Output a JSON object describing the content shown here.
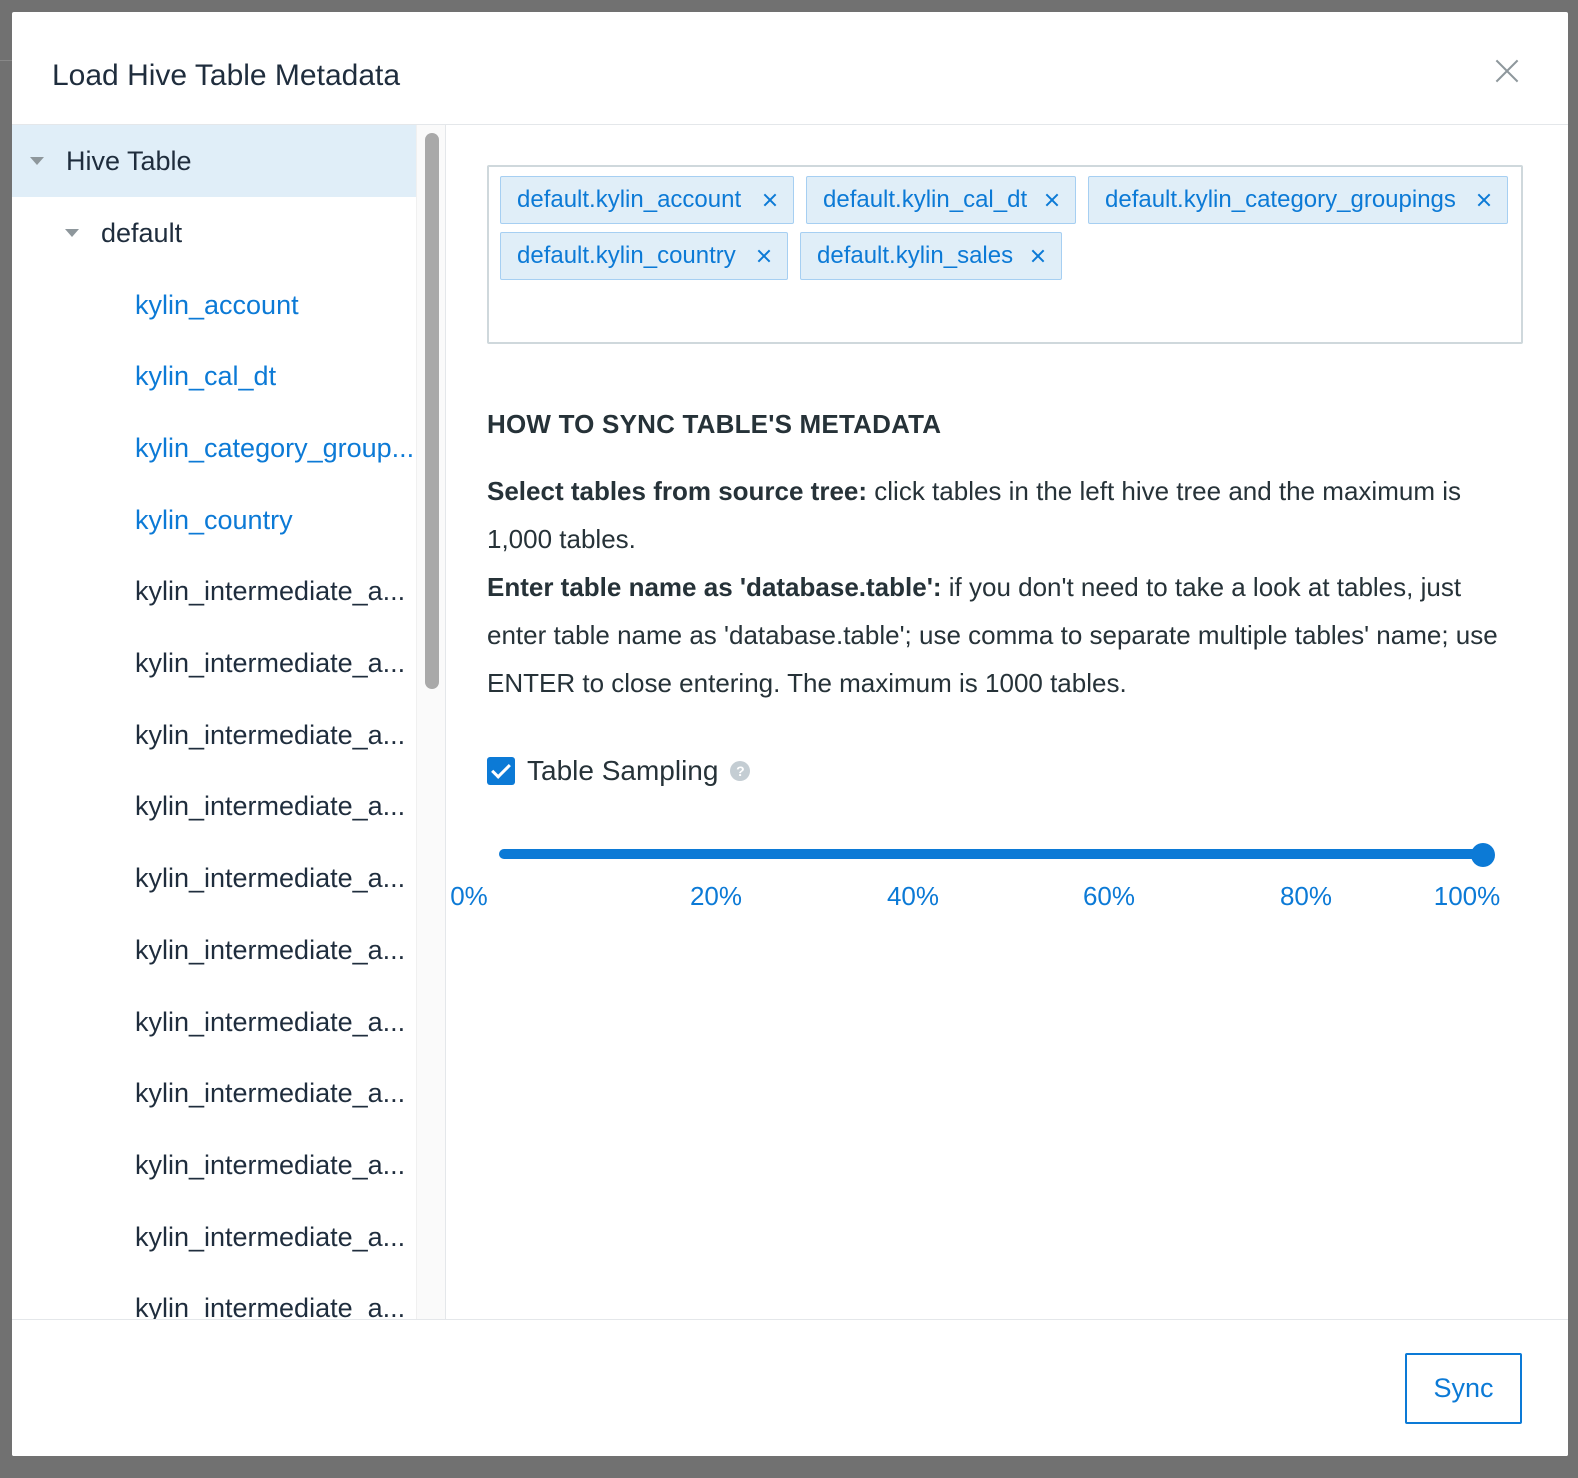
{
  "dialog": {
    "title": "Load Hive Table Metadata"
  },
  "tree": {
    "root_label": "Hive Table",
    "database_label": "default",
    "items": [
      {
        "label": "kylin_account",
        "selected": true
      },
      {
        "label": "kylin_cal_dt",
        "selected": true
      },
      {
        "label": "kylin_category_group...",
        "selected": true
      },
      {
        "label": "kylin_country",
        "selected": true
      },
      {
        "label": "kylin_intermediate_a...",
        "selected": false
      },
      {
        "label": "kylin_intermediate_a...",
        "selected": false
      },
      {
        "label": "kylin_intermediate_a...",
        "selected": false
      },
      {
        "label": "kylin_intermediate_a...",
        "selected": false
      },
      {
        "label": "kylin_intermediate_a...",
        "selected": false
      },
      {
        "label": "kylin_intermediate_a...",
        "selected": false
      },
      {
        "label": "kylin_intermediate_a...",
        "selected": false
      },
      {
        "label": "kylin_intermediate_a...",
        "selected": false
      },
      {
        "label": "kylin_intermediate_a...",
        "selected": false
      },
      {
        "label": "kylin_intermediate_a...",
        "selected": false
      },
      {
        "label": "kylin_intermediate_a...",
        "selected": false
      }
    ]
  },
  "selected_tables": [
    "default.kylin_account",
    "default.kylin_cal_dt",
    "default.kylin_category_groupings",
    "default.kylin_country",
    "default.kylin_sales"
  ],
  "howto": {
    "title": "HOW TO SYNC TABLE'S METADATA",
    "p1_bold": "Select tables from source tree:",
    "p1_text": " click tables in the left hive tree and the maximum is 1,000 tables.",
    "p2_bold": "Enter table name as 'database.table':",
    "p2_text": " if you don't need to take a look at tables, just enter table name as 'database.table'; use comma to separate multiple tables' name; use ENTER to close entering. The maximum is 1000 tables."
  },
  "sampling": {
    "label": "Table Sampling",
    "checked": true,
    "help_glyph": "?",
    "value_percent": 100,
    "ticks": [
      "0%",
      "20%",
      "40%",
      "60%",
      "80%",
      "100%"
    ]
  },
  "footer": {
    "sync_label": "Sync"
  },
  "colors": {
    "accent": "#0c7ad6",
    "tag_bg": "#e0eef8",
    "text": "#263238"
  }
}
